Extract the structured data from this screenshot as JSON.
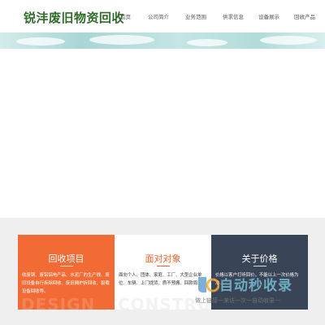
{
  "header": {
    "logo_text": "锐沣废旧物资回收",
    "nav": [
      "首页",
      "公司简介",
      "业务范围",
      "供求信息",
      "设备展示",
      "回收产品"
    ]
  },
  "cards": [
    {
      "title": "回收项目",
      "text": "收废铜、废铝铝电产品、水泥厂的生产线、废旧设备自行拆除回收、废旧厢炉拆回收、裂载设备回收等。",
      "watermark": "DESIGN"
    },
    {
      "title": "面对对象",
      "text": "面向个人、团体、家庭、工厂、大型企业单位、车辆、上门提货、质不预搬、回款周...",
      "watermark": "CONSTRUCT"
    },
    {
      "title": "关于价格",
      "text": "价格以客户打听回价，不能以上一次价格为准...",
      "watermark": ""
    }
  ],
  "overlay": {
    "brand": "自动秒收录",
    "tagline": "做上链接一来访一次一自动收录一"
  },
  "colors": {
    "logo": "#2f6b2a",
    "card_orange": "#f26a34",
    "card_dark": "#394457",
    "accent": "#e8632c",
    "banner": "#a8d6d5"
  }
}
